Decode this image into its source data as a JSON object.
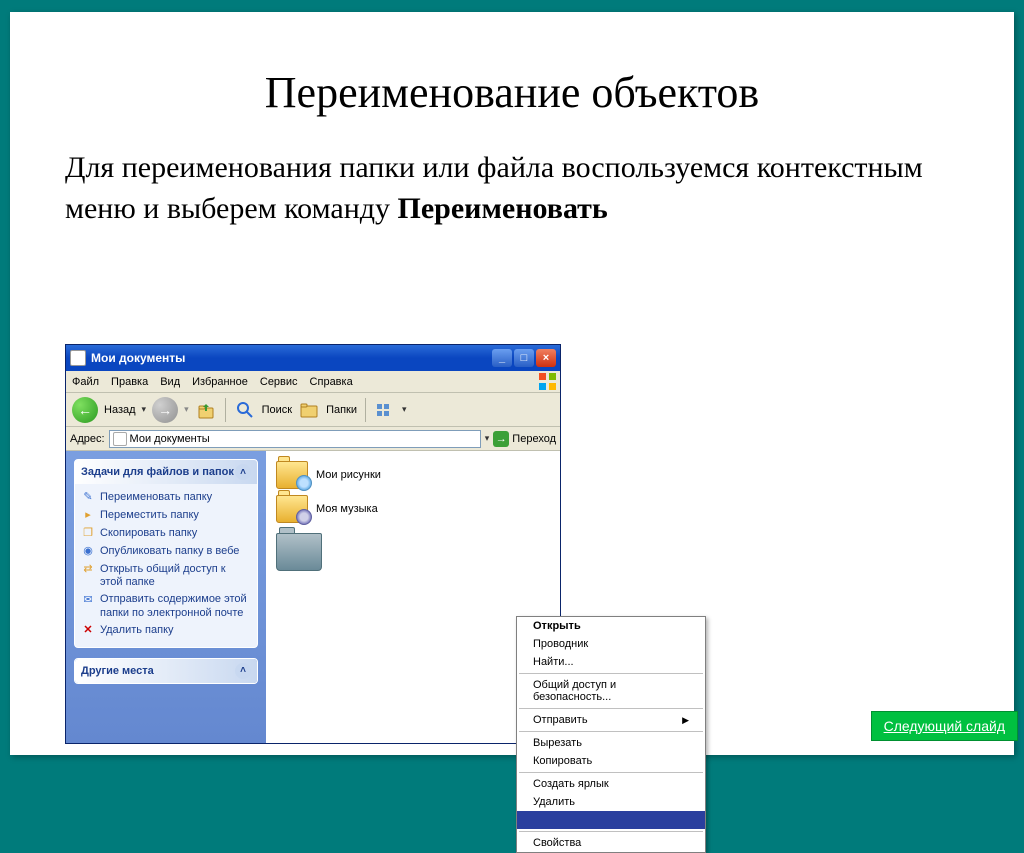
{
  "slide": {
    "title": "Переименование объектов",
    "paragraph_prefix": "Для переименования папки или файла воспользуемся контекстным меню и выберем команду ",
    "paragraph_bold": "Переименовать"
  },
  "explorer": {
    "title": "Мои документы",
    "menubar": [
      "Файл",
      "Правка",
      "Вид",
      "Избранное",
      "Сервис",
      "Справка"
    ],
    "toolbar": {
      "back_label": "Назад",
      "search_label": "Поиск",
      "folders_label": "Папки"
    },
    "address": {
      "label": "Адрес:",
      "value": "Мои документы",
      "go_label": "Переход"
    },
    "sidebar": {
      "tasks_header": "Задачи для файлов и папок",
      "tasks": [
        "Переименовать папку",
        "Переместить папку",
        "Скопировать папку",
        "Опубликовать папку в вебе",
        "Открыть общий доступ к этой папке",
        "Отправить содержимое этой папки по электронной почте",
        "Удалить папку"
      ],
      "places_header": "Другие места"
    },
    "files": {
      "pictures": "Мои рисунки",
      "music": "Моя музыка"
    },
    "context_menu": {
      "open": "Открыть",
      "explorer": "Проводник",
      "find": "Найти...",
      "sharing": "Общий доступ и безопасность...",
      "send_to": "Отправить",
      "cut": "Вырезать",
      "copy": "Копировать",
      "shortcut": "Создать ярлык",
      "delete": "Удалить",
      "rename_highlighted": "",
      "properties": "Свойства"
    }
  },
  "next_button": "Следующий слайд"
}
